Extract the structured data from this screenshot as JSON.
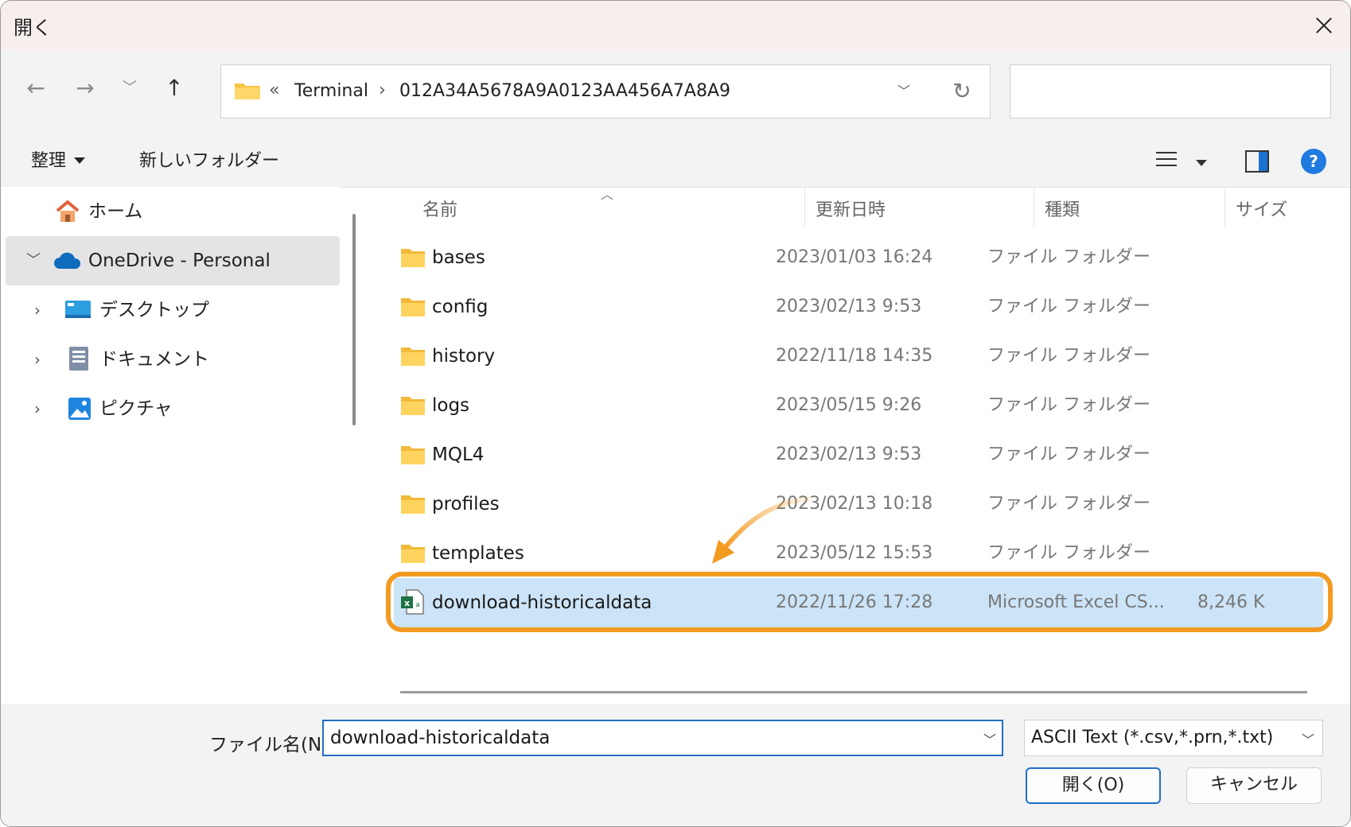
{
  "window": {
    "title": "開く"
  },
  "nav": {
    "back_icon": "arrow-left",
    "forward_icon": "arrow-right",
    "recent_icon": "chevron-down",
    "up_icon": "arrow-up"
  },
  "address": {
    "overflow": "«",
    "crumbs": [
      "Terminal",
      "012A34A5678A9A0123AA456A7A8A9"
    ]
  },
  "search": {
    "value": ""
  },
  "commandbar": {
    "organize_label": "整理",
    "new_folder_label": "新しいフォルダー",
    "help_label": "?"
  },
  "sidebar": {
    "items": [
      {
        "label": "ホーム"
      },
      {
        "label": "OneDrive - Personal"
      },
      {
        "label": "デスクトップ"
      },
      {
        "label": "ドキュメント"
      },
      {
        "label": "ピクチャ"
      }
    ]
  },
  "columns": {
    "name": "名前",
    "date": "更新日時",
    "type": "種類",
    "size": "サイズ"
  },
  "files": [
    {
      "name": "bases",
      "date": "2023/01/03 16:24",
      "type": "ファイル フォルダー",
      "size": ""
    },
    {
      "name": "config",
      "date": "2023/02/13 9:53",
      "type": "ファイル フォルダー",
      "size": ""
    },
    {
      "name": "history",
      "date": "2022/11/18 14:35",
      "type": "ファイル フォルダー",
      "size": ""
    },
    {
      "name": "logs",
      "date": "2023/05/15 9:26",
      "type": "ファイル フォルダー",
      "size": ""
    },
    {
      "name": "MQL4",
      "date": "2023/02/13 9:53",
      "type": "ファイル フォルダー",
      "size": ""
    },
    {
      "name": "profiles",
      "date": "2023/02/13 10:18",
      "type": "ファイル フォルダー",
      "size": ""
    },
    {
      "name": "templates",
      "date": "2023/05/12 15:53",
      "type": "ファイル フォルダー",
      "size": ""
    },
    {
      "name": "download-historicaldata",
      "date": "2022/11/26 17:28",
      "type": "Microsoft Excel CS...",
      "size": "8,246 K"
    }
  ],
  "bottom": {
    "filename_label": "ファイル名(N):",
    "filename_value": "download-historicaldata",
    "filetype_value": "ASCII Text (*.csv,*.prn,*.txt)",
    "open_label": "開く(O)",
    "cancel_label": "キャンセル"
  },
  "colors": {
    "accent": "#1f6fc6",
    "highlight": "#f39a21",
    "selected_row": "#cce4f7",
    "folder": "#f6c543"
  }
}
